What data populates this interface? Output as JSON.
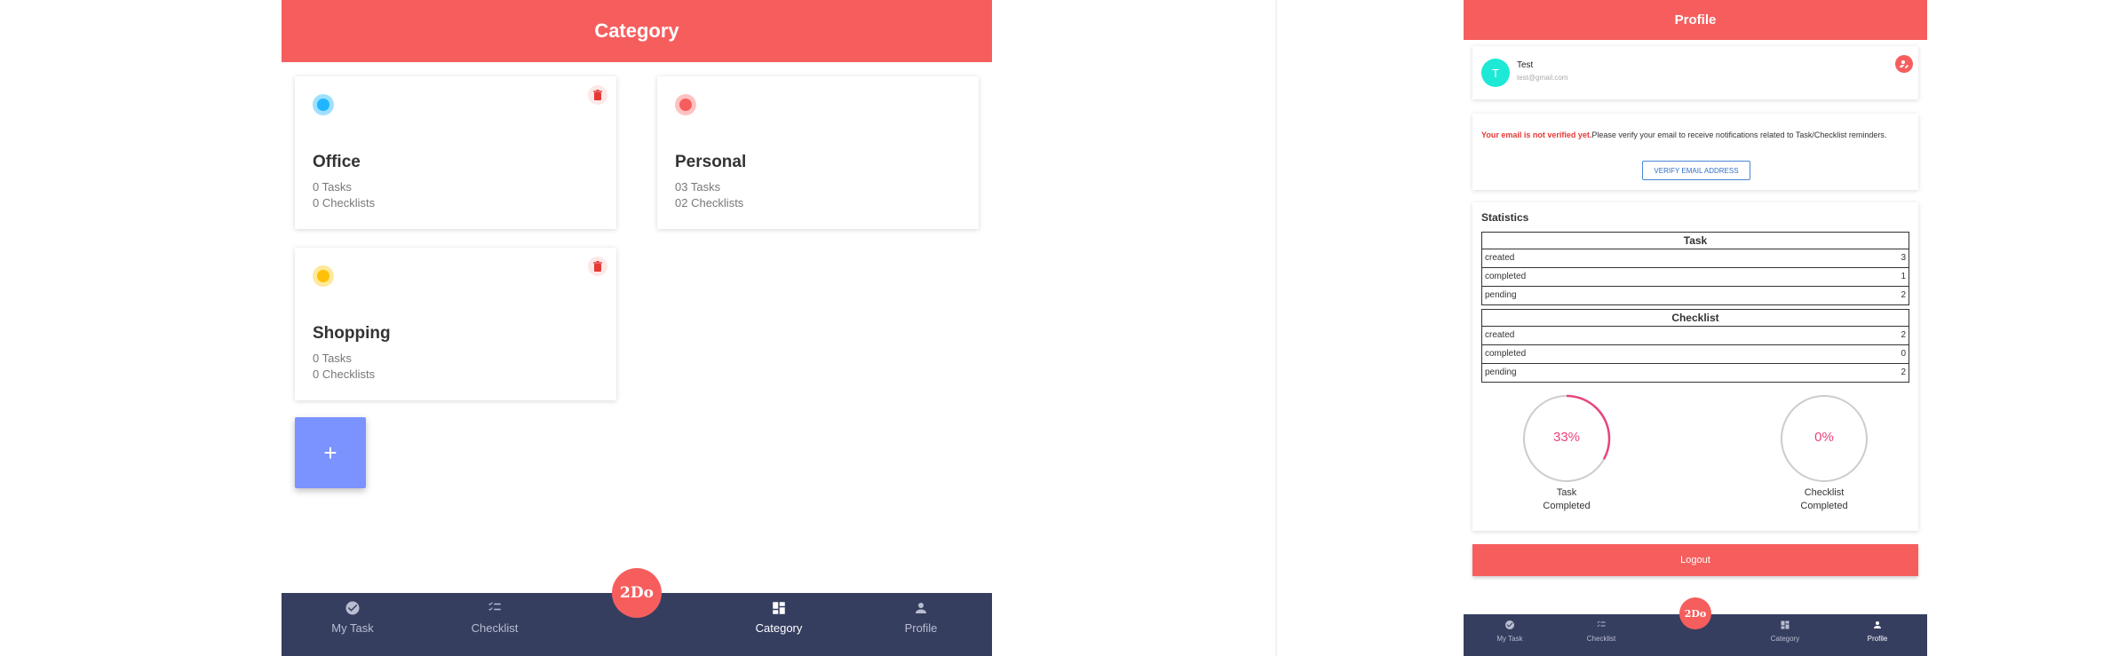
{
  "category_screen": {
    "header_title": "Category",
    "cards": [
      {
        "name": "Office",
        "tasks": "0 Tasks",
        "checklists": "0 Checklists",
        "color": "#1fb5ff",
        "deletable": true
      },
      {
        "name": "Personal",
        "tasks": "03 Tasks",
        "checklists": "02 Checklists",
        "color": "#f65e5e",
        "deletable": false
      },
      {
        "name": "Shopping",
        "tasks": "0 Tasks",
        "checklists": "0 Checklists",
        "color": "#ffc107",
        "deletable": true
      }
    ],
    "add_label": "+",
    "logo_text": "2Do",
    "nav": [
      {
        "label": "My Task",
        "icon": "check-circle-icon",
        "active": false
      },
      {
        "label": "Checklist",
        "icon": "checklist-icon",
        "active": false
      },
      {
        "label": "Category",
        "icon": "dashboard-icon",
        "active": true
      },
      {
        "label": "Profile",
        "icon": "person-icon",
        "active": false
      }
    ]
  },
  "profile_screen": {
    "header_title": "Profile",
    "user": {
      "initial": "T",
      "name": "Test",
      "email": "test@gmail.com",
      "avatar_color": "#1de9d6"
    },
    "verify": {
      "warning": "Your email is not verified yet.",
      "message": "Please verify your email to receive notifications related to Task/Checklist reminders.",
      "button_label": "VERIFY EMAIL ADDRESS"
    },
    "statistics": {
      "title": "Statistics",
      "task": {
        "title": "Task",
        "rows": [
          {
            "label": "created",
            "value": "3"
          },
          {
            "label": "completed",
            "value": "1"
          },
          {
            "label": "pending",
            "value": "2"
          }
        ]
      },
      "checklist": {
        "title": "Checklist",
        "rows": [
          {
            "label": "created",
            "value": "2"
          },
          {
            "label": "completed",
            "value": "0"
          },
          {
            "label": "pending",
            "value": "2"
          }
        ]
      },
      "task_progress": {
        "percent_label": "33%",
        "fraction": 0.33,
        "caption_1": "Task",
        "caption_2": "Completed"
      },
      "checklist_progress": {
        "percent_label": "0%",
        "fraction": 0,
        "caption_1": "Checklist",
        "caption_2": "Completed"
      }
    },
    "logout_label": "Logout",
    "logo_text": "2Do",
    "nav": [
      {
        "label": "My Task",
        "icon": "check-circle-icon",
        "active": false
      },
      {
        "label": "Checklist",
        "icon": "checklist-icon",
        "active": false
      },
      {
        "label": "Category",
        "icon": "dashboard-icon",
        "active": false
      },
      {
        "label": "Profile",
        "icon": "person-icon",
        "active": true
      }
    ]
  },
  "colors": {
    "accent": "#f65e5e",
    "nav_bg": "#363e60",
    "add_button": "#7b93ff",
    "progress": "#e8457a"
  }
}
